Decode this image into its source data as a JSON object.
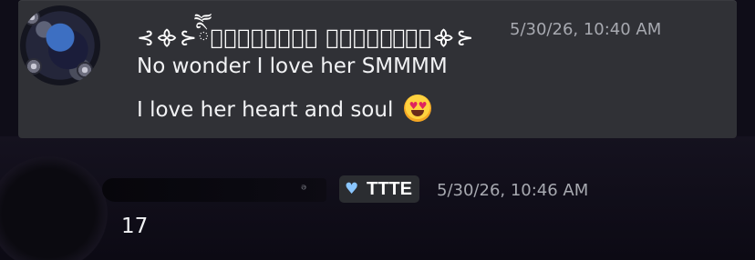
{
  "message_1": {
    "username": "⊰᯽⊱ིཽ☬𝔖𝔞𝔫𝔤𝔲𝔦𝔰 𝔏𝔲𝔫𝔞☬ཽི⊰᯽⊱",
    "timestamp": "5/30/26, 10:40 AM",
    "lines": [
      "No wonder I love her SMMMM",
      "I love her heart and soul"
    ],
    "emoji": "heart-eyes-emoji"
  },
  "message_2": {
    "role_tag": "TTTE",
    "role_icon": "blue-heart-icon",
    "timestamp": "5/30/26, 10:46 AM",
    "content": "17"
  },
  "colors": {
    "card_bg": "#303136",
    "page_bg": "#0f0d18",
    "timestamp": "#a7a9b0",
    "text": "#f2f3f5"
  }
}
